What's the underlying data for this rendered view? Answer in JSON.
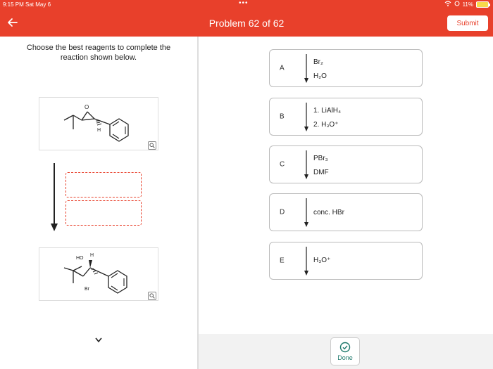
{
  "status": {
    "time": "9:15 PM  Sat May 6",
    "battery": "11%"
  },
  "header": {
    "title": "Problem 62 of 62",
    "submit_label": "Submit"
  },
  "prompt": "Choose the best reagents to complete the reaction shown below.",
  "molecule_top": {
    "label_O": "O",
    "label_H": "H"
  },
  "molecule_bottom": {
    "label_HO": "HO",
    "label_H": "H",
    "label_Br": "Br"
  },
  "options": [
    {
      "letter": "A",
      "line1": "Br₂",
      "line2": "H₂O"
    },
    {
      "letter": "B",
      "line1": "1. LiAlH₄",
      "line2": "2. H₃O⁺"
    },
    {
      "letter": "C",
      "line1": "PBr₃",
      "line2": "DMF"
    },
    {
      "letter": "D",
      "line1": "conc. HBr",
      "line2": ""
    },
    {
      "letter": "E",
      "line1": "H₃O⁺",
      "line2": ""
    }
  ],
  "done_label": "Done",
  "colors": {
    "accent": "#e8402b",
    "done": "#1f7a6d"
  }
}
